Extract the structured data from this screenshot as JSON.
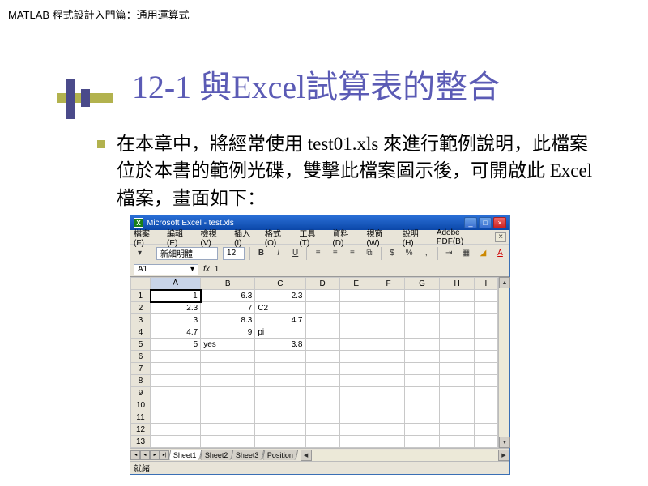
{
  "header": "MATLAB 程式設計入門篇：通用運算式",
  "title": "12-1 與Excel試算表的整合",
  "body_text": "在本章中，將經常使用 test01.xls 來進行範例說明，此檔案位於本書的範例光碟，雙擊此檔案圖示後，可開啟此 Excel 檔案，畫面如下：",
  "excel": {
    "title": "Microsoft Excel - test.xls",
    "menus": [
      "檔案(F)",
      "編輯(E)",
      "檢視(V)",
      "插入(I)",
      "格式(O)",
      "工具(T)",
      "資料(D)",
      "視窗(W)",
      "說明(H)",
      "Adobe PDF(B)"
    ],
    "font_name": "新細明體",
    "font_size": "12",
    "namebox": "A1",
    "formula_value": "1",
    "columns": [
      "A",
      "B",
      "C",
      "D",
      "E",
      "F",
      "G",
      "H",
      "I"
    ],
    "sheets": [
      "Sheet1",
      "Sheet2",
      "Sheet3",
      "Position"
    ],
    "active_sheet": 0,
    "status": "就緒",
    "row_count": 13
  },
  "chart_data": {
    "type": "table",
    "columns": [
      "A",
      "B",
      "C"
    ],
    "rows": [
      {
        "A": 1,
        "B": 6.3,
        "C": 2.3
      },
      {
        "A": 2.3,
        "B": 7,
        "C": "C2"
      },
      {
        "A": 3,
        "B": 8.3,
        "C": 4.7
      },
      {
        "A": 4.7,
        "B": 9,
        "C": "pi"
      },
      {
        "A": 5,
        "B": "yes",
        "C": 3.8
      }
    ]
  }
}
